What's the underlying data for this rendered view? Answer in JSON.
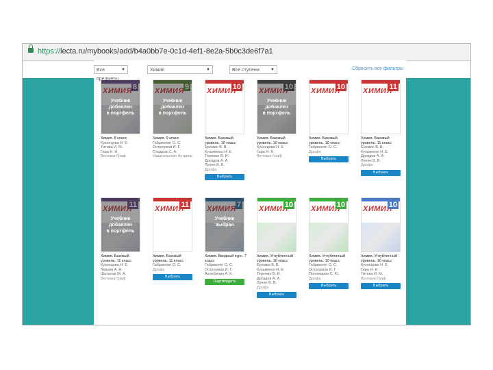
{
  "browser": {
    "url_scheme": "https://",
    "url_rest": "lecta.ru/mybooks/add/b4a0bb7e-0c1d-4ef1-8e2a-5b0c3de6f7a1"
  },
  "filters": {
    "subject": "Все предметы",
    "subject_select": "Химия",
    "level": "Все ступени",
    "link": "Сбросить все фильтры"
  },
  "overlay_text_added": "Учебник\nдобавлен\nв портфель",
  "overlay_text_choice": "Учебник\nвыбран",
  "books": [
    {
      "cover_title": "ХИМИЯ",
      "grade": "8",
      "name": "Химия. 8 класс",
      "authors": "Кузнецова Н. Е.\nТитова И. М.\nГара Н. Н.",
      "publisher": "Вентана-Граф",
      "button": "",
      "overlay": "added",
      "accent": "#6b4b8a"
    },
    {
      "cover_title": "ХИМИЯ",
      "grade": "9",
      "name": "Химия. 9 класс",
      "authors": "Габриелян О. С.\nОстроумов И. Г.\nСладков С. А.",
      "publisher": "Издательство Астрель",
      "button": "",
      "overlay": "added",
      "accent": "#5b8a3a"
    },
    {
      "cover_title": "ХИМИЯ",
      "grade": "10",
      "name": "Химия. Базовый уровень. 10 класс",
      "authors": "Еремин В. В.\nКузьменко Н. Е.\nТеренин В. И.\nДроздов А. А.\nЛунин В. В.",
      "publisher": "Дрофа",
      "button": "Выбрать",
      "overlay": "none",
      "accent": "#c33"
    },
    {
      "cover_title": "ХИМИЯ",
      "grade": "10",
      "name": "Химия. Базовый уровень. 10 класс",
      "authors": "Кузнецова Н. Е.\nГара Н. Н.",
      "publisher": "Вентана-Граф",
      "button": "",
      "overlay": "added",
      "accent": "#4a4a4a"
    },
    {
      "cover_title": "ХИМИЯ",
      "grade": "10",
      "name": "Химия. Базовый уровень. 10 класс",
      "authors": "Габриелян О. С.",
      "publisher": "Дрофа",
      "button": "Выбрать",
      "overlay": "none",
      "accent": "#c33"
    },
    {
      "cover_title": "ХИМИЯ",
      "grade": "11",
      "name": "Химия. Базовый уровень. 11 класс",
      "authors": "Еремин В. В.\nКузьменко Н. Е.\nДроздов А. А.\nЛунин В. В.",
      "publisher": "Дрофа",
      "button": "Выбрать",
      "overlay": "none",
      "accent": "#c33"
    },
    {
      "cover_title": "ХИМИЯ",
      "grade": "11",
      "name": "Химия. Базовый уровень. 11 класс",
      "authors": "Кузнецова Н. Е.\nЛевкин А. Н.\nШаталов М. А.",
      "publisher": "Вентана-Граф",
      "button": "",
      "overlay": "added",
      "accent": "#6b4b8a"
    },
    {
      "cover_title": "ХИМИЯ",
      "grade": "11",
      "name": "Химия. Базовый уровень. 11 класс",
      "authors": "Габриелян О. С.",
      "publisher": "Дрофа",
      "button": "Выбрать",
      "overlay": "none",
      "accent": "#c33"
    },
    {
      "cover_title": "ХИМИЯ",
      "grade": "7",
      "name": "Химия. Вводный курс. 7 класс",
      "authors": "Габриелян О. С.\nОстроумов И. Г.\nАхлебинин А. К.",
      "publisher": "",
      "button": "Подтвердить",
      "overlay": "choice",
      "accent": "#2a6fa8"
    },
    {
      "cover_title": "ХИМИЯ",
      "grade": "10",
      "name": "Химия. Углубленный уровень. 10 класс",
      "authors": "Еремин В. В.\nКузьменко Н. Е.\nТеренин В. И.\nДроздов А. А.\nЛунин В. В.",
      "publisher": "Дрофа",
      "button": "Выбрать",
      "overlay": "none",
      "accent": "#3cae3c"
    },
    {
      "cover_title": "ХИМИЯ",
      "grade": "10",
      "name": "Химия. Углубленный уровень. 10 класс",
      "authors": "Габриелян О. С.\nОстроумов И. Г.\nПономарев С. Ю.",
      "publisher": "Дрофа",
      "button": "Выбрать",
      "overlay": "none",
      "accent": "#3cae3c"
    },
    {
      "cover_title": "ХИМИЯ",
      "grade": "10",
      "name": "Химия. Углубленный уровень. 10 класс",
      "authors": "Кузнецова Н. Е.\nГара Н. Н.\nТитова И. М.",
      "publisher": "Вентана-Граф",
      "button": "Выбрать",
      "overlay": "none",
      "accent": "#4a7ac8"
    }
  ]
}
